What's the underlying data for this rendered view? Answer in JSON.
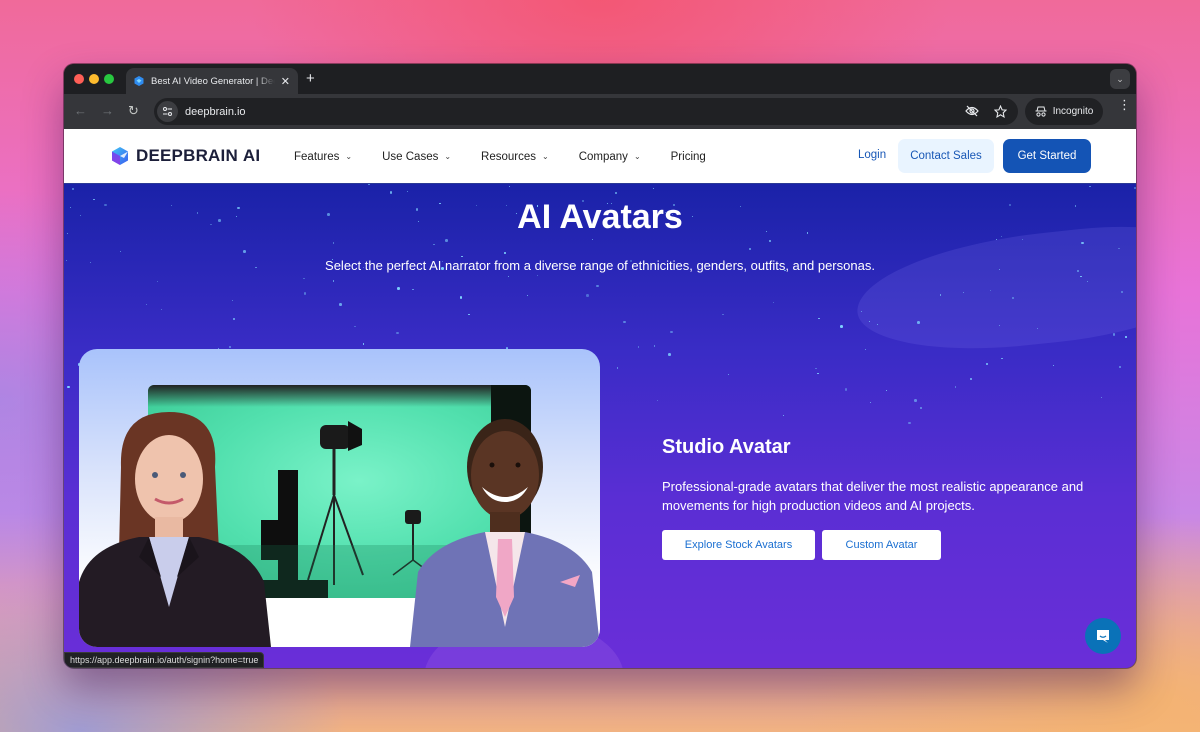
{
  "browser": {
    "tab": {
      "title": "Best AI Video Generator | Deepbrain AI",
      "favicon": "deepbrain-favicon"
    },
    "new_tab_label": "+",
    "url": "deepbrain.io",
    "incognito_label": "Incognito",
    "icons": {
      "back": "←",
      "forward": "→",
      "reload": "↻",
      "close": "✕",
      "tab_search": "⌄",
      "menu": "⋮"
    },
    "status_bar_url": "https://app.deepbrain.io/auth/signin?home=true"
  },
  "site": {
    "logo": {
      "text_main": "DEEPBRAIN",
      "text_accent": "AI"
    },
    "nav": [
      {
        "label": "Features",
        "has_dropdown": true
      },
      {
        "label": "Use Cases",
        "has_dropdown": true
      },
      {
        "label": "Resources",
        "has_dropdown": true
      },
      {
        "label": "Company",
        "has_dropdown": true
      },
      {
        "label": "Pricing",
        "has_dropdown": false
      }
    ],
    "chevron": "⌄",
    "login_label": "Login",
    "contact_sales_label": "Contact Sales",
    "get_started_label": "Get Started"
  },
  "hero": {
    "title": "AI Avatars",
    "subtitle": "Select the perfect AI narrator from a diverse range of ethnicities, genders, outfits, and personas.",
    "section": {
      "title": "Studio Avatar",
      "description": "Professional-grade avatars that deliver the most realistic appearance and movements for high production videos and AI projects.",
      "buttons": [
        {
          "label": "Explore Stock Avatars"
        },
        {
          "label": "Custom Avatar"
        }
      ]
    }
  },
  "colors": {
    "brand_blue": "#1454b5",
    "link_blue": "#1857b6",
    "contact_bg": "#e9f4ff",
    "hero_top": "#1a22a8",
    "hero_bottom": "#6a2ed8",
    "chat_bubble": "#0a72b8"
  }
}
